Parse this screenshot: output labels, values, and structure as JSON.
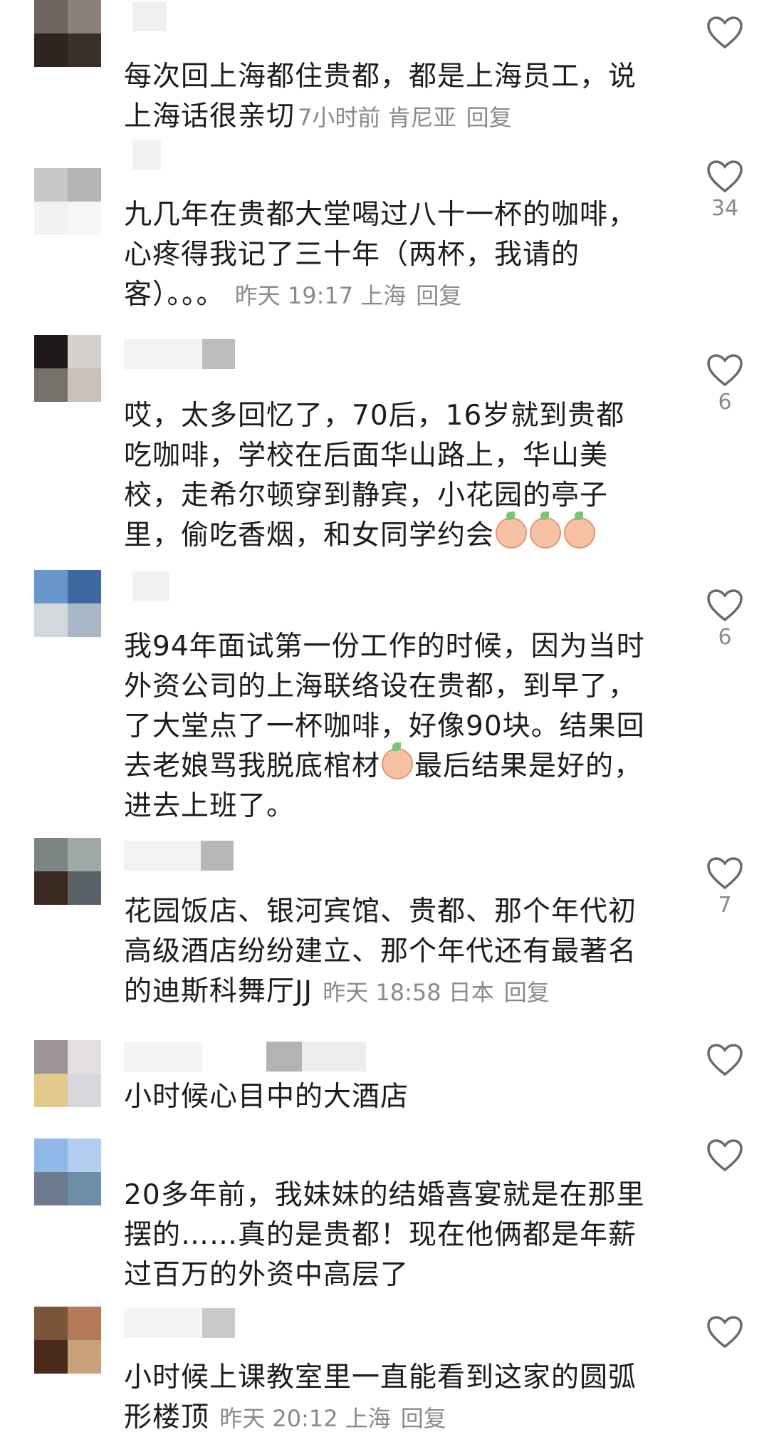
{
  "colors": {
    "text": "#1c1c1c",
    "meta": "#8a8a8a",
    "background": "#ffffff"
  },
  "icons": {
    "like": "heart-outline-icon",
    "emoji": "crying-peach-emoji"
  },
  "comments": [
    {
      "text": "每次回上海都住贵都，都是上海员工，说上海话很亲切",
      "meta": {
        "time": "7小时前",
        "location": "肯尼亚",
        "reply": "回复"
      },
      "likes": "",
      "avatar_colors": [
        "#6e6560",
        "#8a817b",
        "#2e2520",
        "#3a2f29"
      ]
    },
    {
      "text": "九几年在贵都大堂喝过八十一杯的咖啡，心疼得我记了三十年（两杯，我请的客）。。。",
      "meta": {
        "time": "昨天 19:17",
        "location": "上海",
        "reply": "回复"
      },
      "likes": "34",
      "avatar_colors": [
        "#c8c8c8",
        "#b5b5b5",
        "#f2f2f2",
        "#f6f6f6"
      ]
    },
    {
      "text": "哎，太多回忆了，70后，16岁就到贵都吃咖啡，学校在后面华山路上，华山美校，走希尔顿穿到静宾，小花园的亭子里，偷吃香烟，和女同学约会",
      "emoji_count": 3,
      "meta": null,
      "likes": "6",
      "avatar_colors": [
        "#1e1a19",
        "#d4d0cc",
        "#757069",
        "#c9c1b8"
      ]
    },
    {
      "text": "我94年面试第一份工作的时候，因为当时外资公司的上海联络设在贵都，到早了，了大堂点了一杯咖啡，好像90块。结果回去老娘骂我脱底棺材",
      "text_after_emoji": "最后结果是好的，进去上班了。",
      "emoji_count": 1,
      "meta": null,
      "likes": "6",
      "avatar_colors": [
        "#6a97c9",
        "#3f67a0",
        "#d5d8da",
        "#a9b8c6"
      ]
    },
    {
      "text": "花园饭店、银河宾馆、贵都、那个年代初高级酒店纷纷建立、那个年代还有最著名的迪斯科舞厅JJ",
      "meta": {
        "time": "昨天 18:58",
        "location": "日本",
        "reply": "回复"
      },
      "likes": "7",
      "avatar_colors": [
        "#7d8584",
        "#a1a8a8",
        "#3a2a22",
        "#5a6167"
      ]
    },
    {
      "text": "小时候心目中的大酒店",
      "meta": null,
      "likes": "",
      "avatar_colors": [
        "#9c9498",
        "#e3dfe0",
        "#e3c98c",
        "#d8d8dc"
      ]
    },
    {
      "text": "20多年前，我妹妹的结婚喜宴就是在那里摆的……真的是贵都！现在他俩都是年薪过百万的外资中高层了",
      "meta": null,
      "likes": "",
      "avatar_colors": [
        "#8fb8e8",
        "#b3cdf0",
        "#6e7a8e",
        "#6f8fa8"
      ]
    },
    {
      "text": "小时候上课教室里一直能看到这家的圆弧形楼顶",
      "meta": {
        "time": "昨天 20:12",
        "location": "上海",
        "reply": "回复"
      },
      "likes": "",
      "avatar_colors": [
        "#7a5538",
        "#b47a58",
        "#4a2a1a",
        "#c9a27c"
      ]
    }
  ]
}
